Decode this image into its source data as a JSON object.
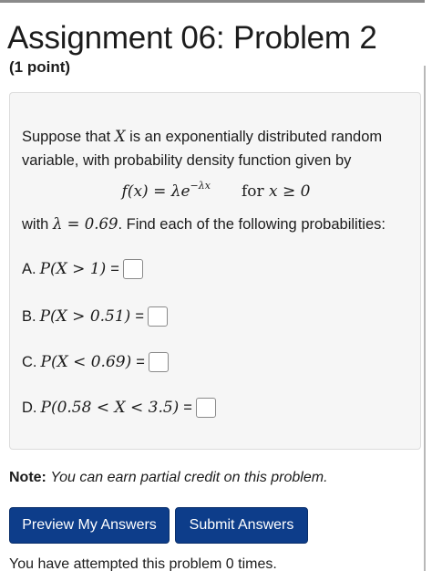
{
  "header": {
    "title": "Assignment 06: Problem 2",
    "points": "(1 point)"
  },
  "problem": {
    "intro_1": "Suppose that ",
    "intro_var": "X",
    "intro_2": " is an exponentially distributed random variable, with probability density function given by",
    "formula_lhs": "f(x) = λe",
    "formula_exp": "−λx",
    "formula_for": "for ",
    "formula_cond": "x ≥ 0",
    "lambda_prefix": "with ",
    "lambda_expr": "λ = 0.69",
    "lambda_suffix": ". Find each of the following probabilities:",
    "parts": [
      {
        "letter": "A.",
        "expr": "P(X > 1)"
      },
      {
        "letter": "B.",
        "expr": "P(X > 0.51)"
      },
      {
        "letter": "C.",
        "expr": "P(X < 0.69)"
      },
      {
        "letter": "D.",
        "expr": "P(0.58 < X < 3.5)"
      }
    ],
    "equals": "="
  },
  "note": {
    "label": "Note:",
    "text": "You can earn partial credit on this problem."
  },
  "buttons": {
    "preview": "Preview My Answers",
    "submit": "Submit Answers"
  },
  "status": {
    "attempts": "You have attempted this problem 0 times."
  },
  "colors": {
    "button_bg": "#0d3d8a",
    "panel_bg": "#f6f6f6"
  }
}
